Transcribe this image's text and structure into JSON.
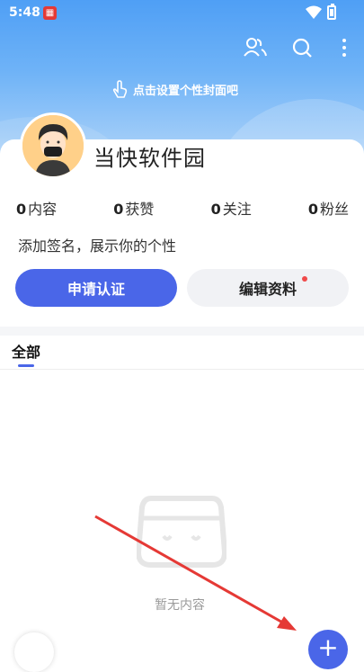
{
  "status_bar": {
    "time": "5:48",
    "app_icon": "app-notification-icon",
    "wifi": "wifi-icon",
    "battery": "battery-icon"
  },
  "top_actions": [
    {
      "name": "friends-icon"
    },
    {
      "name": "search-icon"
    },
    {
      "name": "more-icon"
    }
  ],
  "cover": {
    "hint": "点击设置个性封面吧",
    "hint_icon": "tap-hand-icon"
  },
  "profile": {
    "username": "当快软件园",
    "stats": [
      {
        "count": "0",
        "label": "内容"
      },
      {
        "count": "0",
        "label": "获赞"
      },
      {
        "count": "0",
        "label": "关注"
      },
      {
        "count": "0",
        "label": "粉丝"
      }
    ],
    "signature": "添加签名，展示你的个性"
  },
  "buttons": {
    "apply_verify": "申请认证",
    "edit_profile": "编辑资料"
  },
  "tabs": [
    {
      "label": "全部"
    }
  ],
  "empty_state": {
    "text": "暂无内容",
    "icon": "empty-box-icon"
  },
  "fab": {
    "label": "+",
    "icon": "plus-icon"
  },
  "colors": {
    "accent": "#4a66e8",
    "cover": "#5fa8f6",
    "dot": "#f04a4a",
    "annotation_arrow": "#e53935"
  }
}
